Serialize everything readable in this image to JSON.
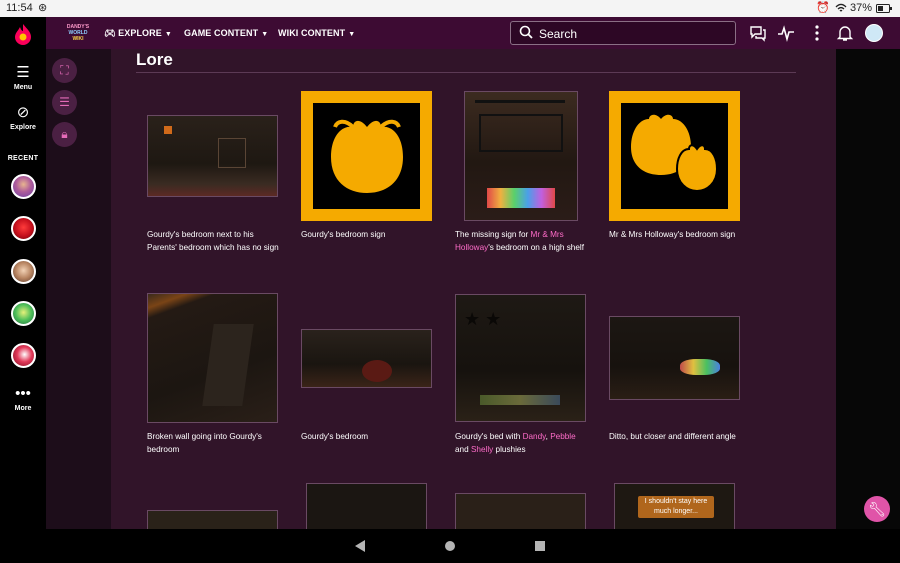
{
  "status": {
    "time": "11:54",
    "battery": "37%"
  },
  "rail": {
    "menu_label": "Menu",
    "explore_label": "Explore",
    "recent_label": "RECENT",
    "more_label": "More"
  },
  "topbar": {
    "wiki_logo_lines": [
      "DANDY'S",
      "WORLD",
      "WIKI"
    ],
    "nav": [
      {
        "label": "EXPLORE"
      },
      {
        "label": "GAME CONTENT"
      },
      {
        "label": "WIKI CONTENT"
      }
    ],
    "search_placeholder": "Search"
  },
  "section_title": "Lore",
  "cards": [
    {
      "caption_parts": [
        {
          "t": "Gourdy's bedroom next to his Parents' bedroom which has no sign"
        }
      ]
    },
    {
      "caption_parts": [
        {
          "t": "Gourdy's bedroom sign"
        }
      ]
    },
    {
      "caption_parts": [
        {
          "t": "The missing sign for "
        },
        {
          "t": "Mr & Mrs Holloway",
          "link": true
        },
        {
          "t": "'s bedroom on a high shelf"
        }
      ]
    },
    {
      "caption_parts": [
        {
          "t": "Mr & Mrs Holloway's bedroom sign"
        }
      ]
    },
    {
      "caption_parts": [
        {
          "t": "Broken wall going into Gourdy's bedroom"
        }
      ]
    },
    {
      "caption_parts": [
        {
          "t": "Gourdy's bedroom"
        }
      ]
    },
    {
      "caption_parts": [
        {
          "t": "Gourdy's bed with "
        },
        {
          "t": "Dandy",
          "link": true
        },
        {
          "t": ", "
        },
        {
          "t": "Pebble",
          "link": true
        },
        {
          "t": " and "
        },
        {
          "t": "Shelly",
          "link": true
        },
        {
          "t": " plushies"
        }
      ]
    },
    {
      "caption_parts": [
        {
          "t": "Ditto, but closer and different angle"
        }
      ]
    }
  ],
  "bottom_thumb_text": "I shouldn't stay here much longer...",
  "colors": {
    "accent": "#e054a8",
    "link": "#ff6cc9",
    "sign": "#f5aa00",
    "topbar": "#3d0b33",
    "content": "#311429"
  }
}
